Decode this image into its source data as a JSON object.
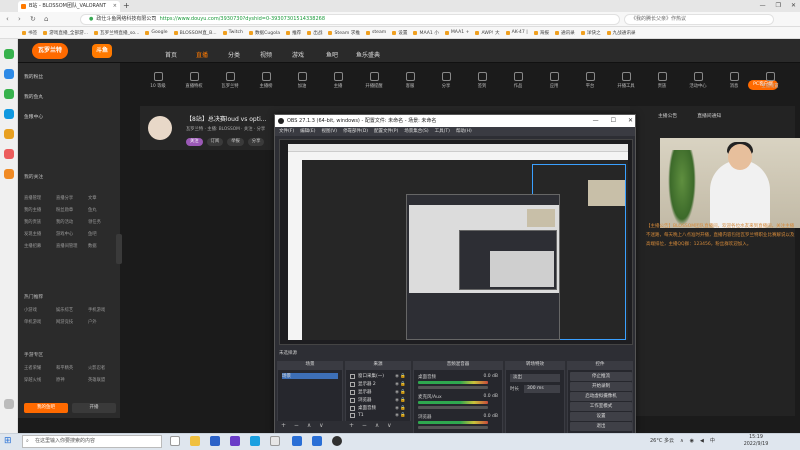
{
  "browser": {
    "tab_title": "B站 - BLOSSOM团队_VALORANT",
    "new_tab_symbol": "+",
    "window_controls": [
      "—",
      "❐",
      "✕"
    ],
    "url_secure_label": "政仕斗鱼网络科技有限公司",
    "url": "https://www.douyu.com/3930730?dyshid=0-39307301514338268",
    "search_placeholder": "《我的腾长父亲》作热议",
    "bookmarks": [
      "书签",
      "游戏直播_全部游...",
      "瓦罗兰特直播_so...",
      "Google",
      "BLOSSOM直_B...",
      "Twitch",
      "数据Cugola",
      "推荐",
      "出战",
      "Steam 求推",
      "steam",
      "设置",
      "MAA1 小",
      "MAA1 +",
      "AWP! 大",
      "AK-47 |",
      "海报",
      "通讯录",
      "洋快之",
      "九战通讯录"
    ]
  },
  "site": {
    "logo": "瓦罗兰特",
    "logo_brand": "斗鱼",
    "nav": [
      "首页",
      "直播",
      "分类",
      "视频",
      "游戏",
      "鱼吧",
      "鱼乐盛典"
    ],
    "pc_button": "PC客户端",
    "top_icons": [
      "10 等级",
      "直播特权",
      "瓦罗兰特",
      "主播榜",
      "加油",
      "主播",
      "开播提醒",
      "客服",
      "分享",
      "签到",
      "作品",
      "应用",
      "平台",
      "开播工具",
      "贵族",
      "活动中心",
      "消息",
      "主播设置"
    ],
    "sidebar_top": [
      "我的粉丝",
      "我的鱼丸",
      "鱼粮中心"
    ],
    "sidebar_section1": "我的关注",
    "sidebar_grid1": [
      "直播管理",
      "直播分享",
      "文章",
      "我的主播",
      "粉丝勋章",
      "鱼丸",
      "我的贵族",
      "我的活动",
      "领任务",
      "发现主播",
      "游戏中心",
      "鱼吧",
      "主播招募",
      "直播间管理",
      "数据"
    ],
    "sidebar_section2": "热门推荐",
    "sidebar_grid2": [
      "小游戏",
      "娱乐综艺",
      "手机游戏",
      "单机游戏",
      "网游竞技",
      "户外"
    ],
    "sidebar_section3": "手游专区",
    "sidebar_grid3": [
      "王者荣耀",
      "和平精英",
      "火影忍者",
      "穿越火线",
      "原神",
      "英雄联盟"
    ],
    "sidebar_buttons": [
      "我的鱼吧",
      "开播"
    ],
    "streamer": {
      "title": "【8站】总决赛loud vs opti...",
      "tags": "瓦罗兰特 · 主播: BLOSSOM · 关注 · 分享",
      "buttons": [
        "关注",
        "订阅",
        "举报",
        "分享"
      ]
    },
    "right_tabs": [
      "主播公告",
      "直播间通知"
    ],
    "right_text": "【主播公告】BLOSSOM团队直播间，欢迎各位水友来到直播间，关注主播不迷路，每天晚上八点准时开播，直播内容包括瓦罗兰特职业比赛解说以及高端排位，主播QQ群：123456，粉丝群欢迎加入。"
  },
  "obs": {
    "title": "OBS 27.1.3 (64-bit, windows) - 配置文件: 未命名 - 场景: 未命名",
    "menu": [
      "文件(F)",
      "编辑(E)",
      "视图(V)",
      "停靠部件(D)",
      "配置文件(P)",
      "场景集合(S)",
      "工具(T)",
      "帮助(H)"
    ],
    "scene_header": "未选择源",
    "docks": {
      "scenes": {
        "title": "场景",
        "items": [
          "场景"
        ]
      },
      "sources": {
        "title": "来源",
        "items": [
          "窗口采集(一)",
          "显示器 2",
          "显示器",
          "浏览器",
          "桌面音频",
          "T1"
        ]
      },
      "mixer": {
        "title": "音频混音器",
        "channels": [
          "桌面音频",
          "麦克风/Aux",
          "浏览器"
        ],
        "levels": [
          "0.0 dB",
          "0.0 dB",
          "0.0 dB"
        ]
      },
      "transitions": {
        "title": "转场特效",
        "type": "淡出",
        "duration_label": "时长",
        "duration": "300 ms"
      },
      "controls": {
        "title": "控件",
        "buttons": [
          "停止推流",
          "开始录制",
          "启动虚拟摄像机",
          "工作室模式",
          "设置",
          "退出"
        ]
      }
    },
    "foot_symbols": "+ − ∧ ∨"
  },
  "taskbar": {
    "search_placeholder": "在这里输入你要搜索的内容",
    "weather": "26°C 多云",
    "ime": "中",
    "time": "15:19",
    "date": "2022/9/19"
  }
}
